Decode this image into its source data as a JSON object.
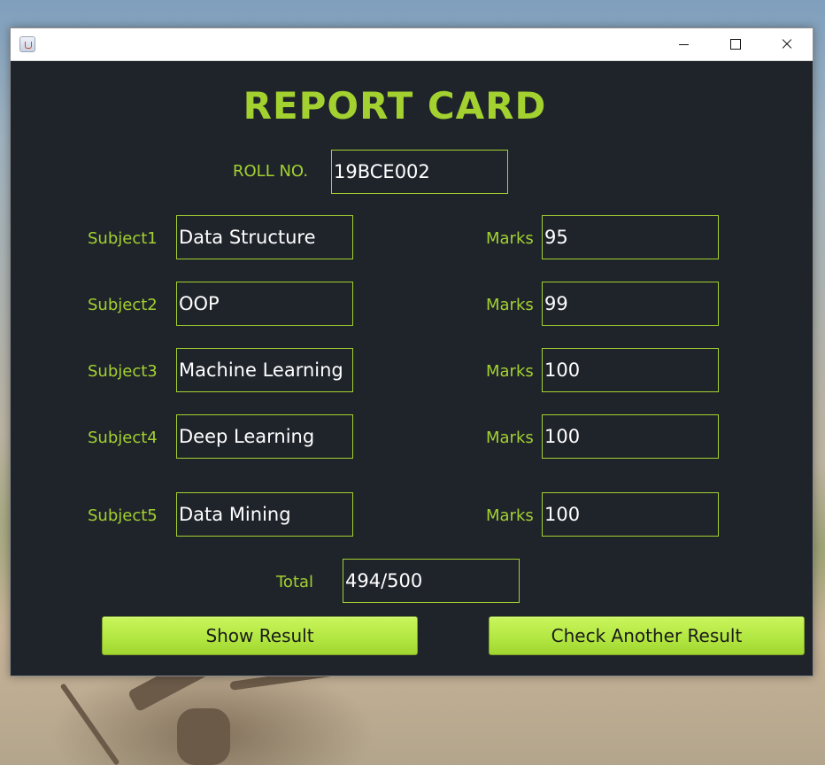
{
  "title_bar": {
    "icon": "java-cup-icon",
    "controls": [
      "minimize-icon",
      "maximize-icon",
      "close-icon"
    ]
  },
  "form": {
    "heading": "REPORT CARD",
    "roll_no": {
      "label": "ROLL NO.",
      "value": "19BCE002"
    },
    "subjects": [
      {
        "label": "Subject1",
        "name": "Data Structure",
        "marks_label": "Marks",
        "marks": "95"
      },
      {
        "label": "Subject2",
        "name": "OOP",
        "marks_label": "Marks",
        "marks": "99"
      },
      {
        "label": "Subject3",
        "name": "Machine Learning",
        "marks_label": "Marks",
        "marks": "100"
      },
      {
        "label": "Subject4",
        "name": "Deep Learning",
        "marks_label": "Marks",
        "marks": "100"
      },
      {
        "label": "Subject5",
        "name": "Data Mining",
        "marks_label": "Marks",
        "marks": "100"
      }
    ],
    "total": {
      "label": "Total",
      "value": "494/500"
    }
  },
  "buttons": {
    "show_result": "Show Result",
    "check_another": "Check Another Result"
  },
  "colors": {
    "accent": "#a3d12f",
    "panel_background": "#1f242b",
    "field_text": "#ffffff",
    "button_fill": "#b4e844"
  }
}
